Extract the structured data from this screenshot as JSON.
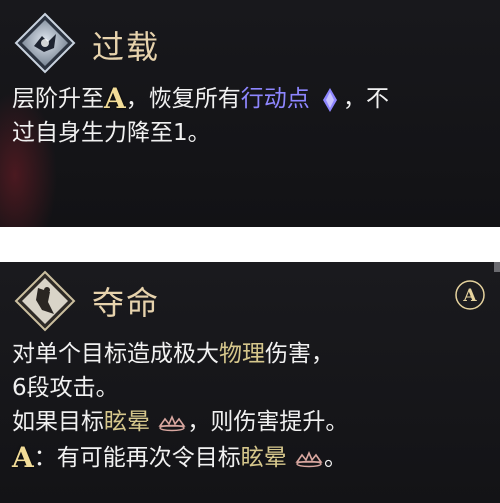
{
  "card1": {
    "title": "过载",
    "line1_a": "层阶升至",
    "rank": "A",
    "line1_b": "，恢复所有",
    "line1_kw": "行动点",
    "line1_c": "，不",
    "line2": "过自身生力降至1。",
    "icon": "overload-icon",
    "action-point-icon": "blue-diamond-icon"
  },
  "card2": {
    "title": "夺命",
    "rank_badge": "A",
    "line1_a": "对单个目标造成极大",
    "line1_kw": "物理",
    "line1_b": "伤害，",
    "line2": "6段攻击。",
    "line3_a": "如果目标",
    "line3_kw": "眩晕",
    "line3_b": "，则伤害提升。",
    "line4_rank": "A",
    "line4_a": "：有可能再次令目标",
    "line4_kw": "眩晕",
    "line4_b": "。",
    "icon": "lethal-strike-icon",
    "stun-icon": "stun-crown-icon"
  },
  "colors": {
    "title": "#e7d3ad",
    "keyword_blue": "#8e86ff",
    "keyword_gold": "#d6c78c",
    "rank": "#f2dc98"
  }
}
